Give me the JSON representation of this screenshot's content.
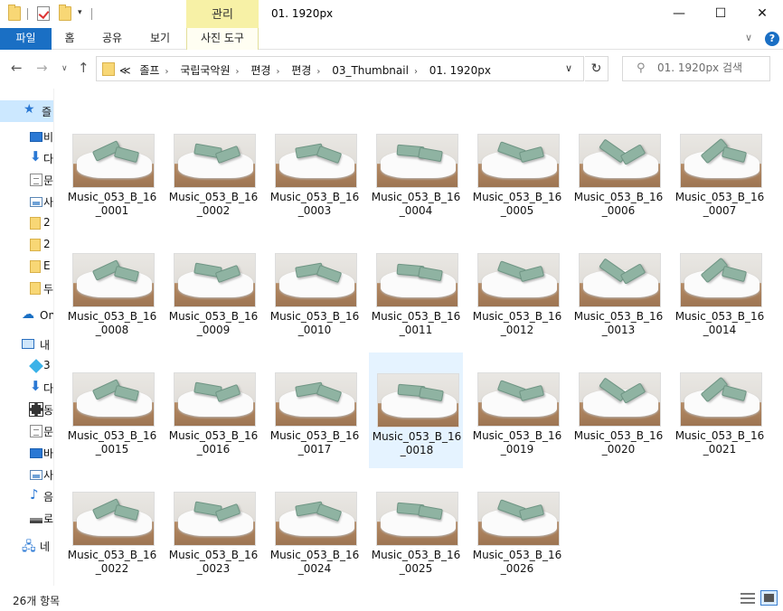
{
  "window": {
    "title": "01. 1920px",
    "context_tab": "관리",
    "minimize": "—",
    "maximize": "☐",
    "close": "✕"
  },
  "ribbon": {
    "tabs": [
      "파일",
      "홈",
      "공유",
      "보기",
      "사진 도구"
    ]
  },
  "address": {
    "crumbs": [
      "≪",
      "졸프",
      "국립국악원",
      "편경",
      "편경",
      "03_Thumbnail",
      "01. 1920px"
    ]
  },
  "search": {
    "placeholder": "01. 1920px 검색"
  },
  "nav_pane": {
    "items": [
      {
        "label": "즐",
        "icon": "star-icon"
      },
      {
        "label": "비",
        "icon": "desktop-icon"
      },
      {
        "label": "다",
        "icon": "download-icon"
      },
      {
        "label": "문",
        "icon": "document-icon"
      },
      {
        "label": "사",
        "icon": "pictures-icon"
      },
      {
        "label": "2",
        "icon": "folder-icon"
      },
      {
        "label": "2",
        "icon": "folder-icon"
      },
      {
        "label": "E",
        "icon": "folder-icon"
      },
      {
        "label": "두",
        "icon": "folder-icon"
      },
      {
        "label": "On",
        "icon": "onedrive-icon"
      },
      {
        "label": "내",
        "icon": "pc-icon"
      },
      {
        "label": "3",
        "icon": "3d-objects-icon"
      },
      {
        "label": "다",
        "icon": "download-icon"
      },
      {
        "label": "동",
        "icon": "video-icon"
      },
      {
        "label": "문",
        "icon": "document-icon"
      },
      {
        "label": "바",
        "icon": "desktop-icon"
      },
      {
        "label": "사",
        "icon": "pictures-icon"
      },
      {
        "label": "음",
        "icon": "music-icon"
      },
      {
        "label": "로",
        "icon": "drive-icon"
      },
      {
        "label": "네",
        "icon": "network-icon"
      }
    ]
  },
  "files": [
    {
      "line1": "Music_053_B_16",
      "line2": "_0001"
    },
    {
      "line1": "Music_053_B_16",
      "line2": "_0002"
    },
    {
      "line1": "Music_053_B_16",
      "line2": "_0003"
    },
    {
      "line1": "Music_053_B_16",
      "line2": "_0004"
    },
    {
      "line1": "Music_053_B_16",
      "line2": "_0005"
    },
    {
      "line1": "Music_053_B_16",
      "line2": "_0006"
    },
    {
      "line1": "Music_053_B_16",
      "line2": "_0007"
    },
    {
      "line1": "Music_053_B_16",
      "line2": "_0008"
    },
    {
      "line1": "Music_053_B_16",
      "line2": "_0009"
    },
    {
      "line1": "Music_053_B_16",
      "line2": "_0010"
    },
    {
      "line1": "Music_053_B_16",
      "line2": "_0011"
    },
    {
      "line1": "Music_053_B_16",
      "line2": "_0012"
    },
    {
      "line1": "Music_053_B_16",
      "line2": "_0013"
    },
    {
      "line1": "Music_053_B_16",
      "line2": "_0014"
    },
    {
      "line1": "Music_053_B_16",
      "line2": "_0015"
    },
    {
      "line1": "Music_053_B_16",
      "line2": "_0016"
    },
    {
      "line1": "Music_053_B_16",
      "line2": "_0017"
    },
    {
      "line1": "Music_053_B_16",
      "line2": "_0018"
    },
    {
      "line1": "Music_053_B_16",
      "line2": "_0019"
    },
    {
      "line1": "Music_053_B_16",
      "line2": "_0020"
    },
    {
      "line1": "Music_053_B_16",
      "line2": "_0021"
    },
    {
      "line1": "Music_053_B_16",
      "line2": "_0022"
    },
    {
      "line1": "Music_053_B_16",
      "line2": "_0023"
    },
    {
      "line1": "Music_053_B_16",
      "line2": "_0024"
    },
    {
      "line1": "Music_053_B_16",
      "line2": "_0025"
    },
    {
      "line1": "Music_053_B_16",
      "line2": "_0026"
    }
  ],
  "selected_file": "_0018",
  "status": {
    "count": "26개 항목"
  },
  "colors": {
    "accent": "#1a6fc4",
    "context_tab": "#f7f1a6",
    "selection": "#e5f3ff",
    "tile": "#8fb3a2"
  }
}
